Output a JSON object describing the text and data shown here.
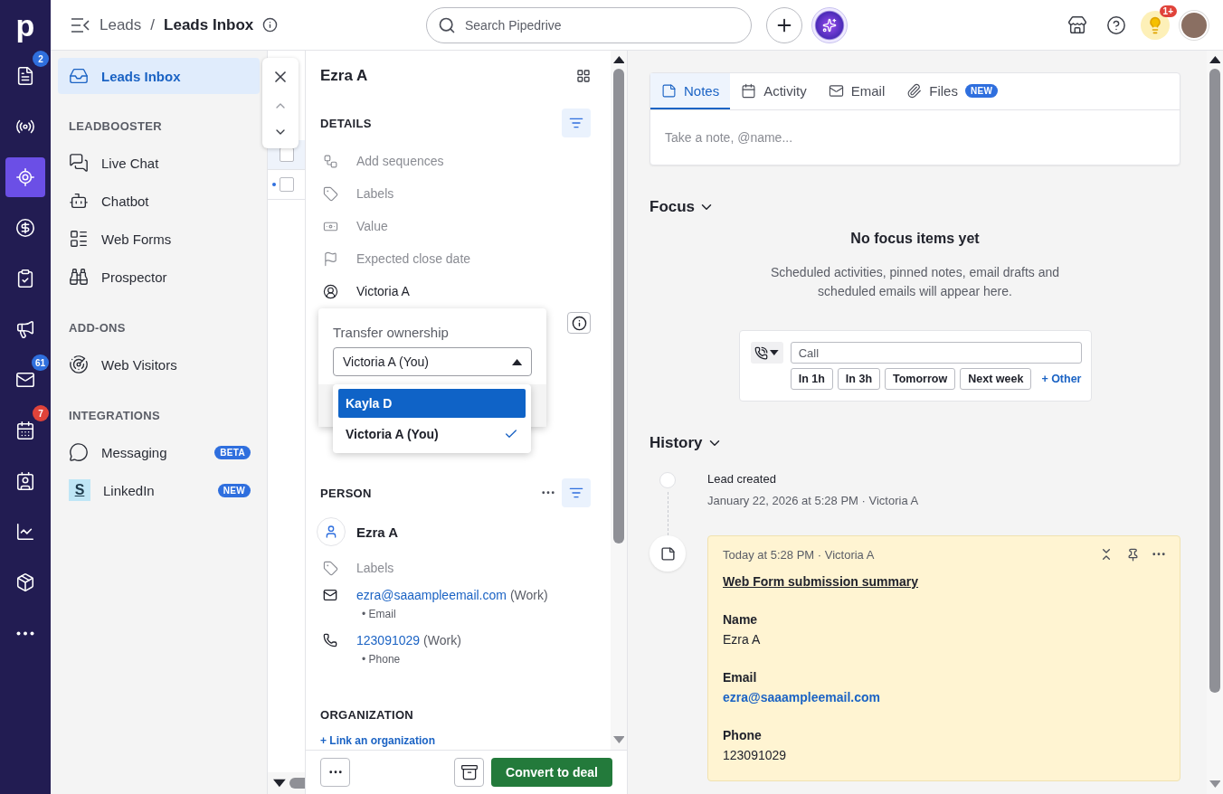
{
  "rail": {
    "logo": "p",
    "items": [
      {
        "selected": false,
        "badge": {
          "text": "2",
          "color": "#2f6fde"
        }
      },
      {
        "selected": false
      },
      {
        "selected": true
      },
      {
        "selected": false
      },
      {
        "selected": false
      },
      {
        "selected": false
      },
      {
        "selected": false,
        "badge": {
          "text": "61",
          "color": "#2f6fde"
        }
      },
      {
        "selected": false,
        "badge": {
          "text": "7",
          "color": "#e0433a"
        }
      },
      {
        "selected": false
      },
      {
        "selected": false
      },
      {
        "selected": false
      },
      {
        "selected": false
      }
    ]
  },
  "header": {
    "breadcrumb": {
      "parent": "Leads",
      "separator": "/",
      "current": "Leads Inbox"
    },
    "search": {
      "placeholder": "Search Pipedrive"
    },
    "notification_badge": "1+"
  },
  "sidebar": {
    "top": [
      {
        "label": "Leads Inbox",
        "selected": true
      }
    ],
    "sections": [
      {
        "title": "LEADBOOSTER",
        "items": [
          {
            "label": "Live Chat",
            "selected": false
          },
          {
            "label": "Chatbot",
            "selected": false
          },
          {
            "label": "Web Forms",
            "selected": false
          },
          {
            "label": "Prospector",
            "selected": false
          }
        ]
      },
      {
        "title": "ADD-ONS",
        "items": [
          {
            "label": "Web Visitors",
            "selected": false
          }
        ]
      },
      {
        "title": "INTEGRATIONS",
        "items": [
          {
            "label": "Messaging",
            "selected": false,
            "badge": "BETA"
          },
          {
            "label": "LinkedIn",
            "selected": false,
            "badge": "NEW",
            "logo": "S"
          }
        ]
      }
    ]
  },
  "list_rows": [
    {
      "selected": true,
      "checked": false,
      "unread": false
    },
    {
      "selected": false,
      "checked": false,
      "unread": true
    }
  ],
  "detail": {
    "title": "Ezra A",
    "details": {
      "heading": "DETAILS",
      "fields": [
        {
          "text": "Add sequences",
          "empty": true
        },
        {
          "text": "Labels",
          "empty": true
        },
        {
          "text": "Value",
          "empty": true
        },
        {
          "text": "Expected close date",
          "empty": true
        },
        {
          "text": "Victoria A",
          "empty": false
        }
      ]
    },
    "ownership_popover": {
      "label": "Transfer ownership",
      "value": "Victoria A (You)",
      "expanded": true,
      "options": [
        {
          "label": "Kayla D",
          "selected": false,
          "highlighted": true
        },
        {
          "label": "Victoria A (You)",
          "selected": true,
          "highlighted": false
        }
      ]
    },
    "person": {
      "heading": "PERSON",
      "name": "Ezra A",
      "labels": "Labels",
      "email": {
        "value": "ezra@saaampleemail.com",
        "type": "(Work)",
        "caption": "• Email"
      },
      "phone": {
        "value": "123091029",
        "type": "(Work)",
        "caption": "• Phone"
      }
    },
    "organization": {
      "heading": "ORGANIZATION",
      "link": "+ Link an organization"
    },
    "footer": {
      "convert": "Convert to deal"
    }
  },
  "composer": {
    "tabs": [
      {
        "label": "Notes",
        "selected": true
      },
      {
        "label": "Activity",
        "selected": false
      },
      {
        "label": "Email",
        "selected": false
      },
      {
        "label": "Files",
        "selected": false,
        "badge": "NEW"
      }
    ],
    "placeholder": "Take a note, @name..."
  },
  "focus": {
    "title": "Focus",
    "expanded": true,
    "empty_title": "No focus items yet",
    "empty_text": "Scheduled activities, pinned notes, email drafts and scheduled emails will appear here.",
    "activity": {
      "placeholder": "Call",
      "quick": [
        "In 1h",
        "In 3h",
        "Tomorrow",
        "Next week"
      ],
      "other": "+ Other"
    }
  },
  "history": {
    "title": "History",
    "expanded": true,
    "events": [
      {
        "kind": "event",
        "title": "Lead created",
        "meta": "January 22, 2026 at 5:28 PM · Victoria A"
      },
      {
        "kind": "note",
        "meta": "Today at 5:28 PM · Victoria A",
        "title": "Web Form submission summary",
        "fields": [
          {
            "label": "Name",
            "value": "Ezra A",
            "link": false
          },
          {
            "label": "Email",
            "value": "ezra@saaampleemail.com",
            "link": true
          },
          {
            "label": "Phone",
            "value": "123091029",
            "link": false
          }
        ]
      }
    ]
  }
}
